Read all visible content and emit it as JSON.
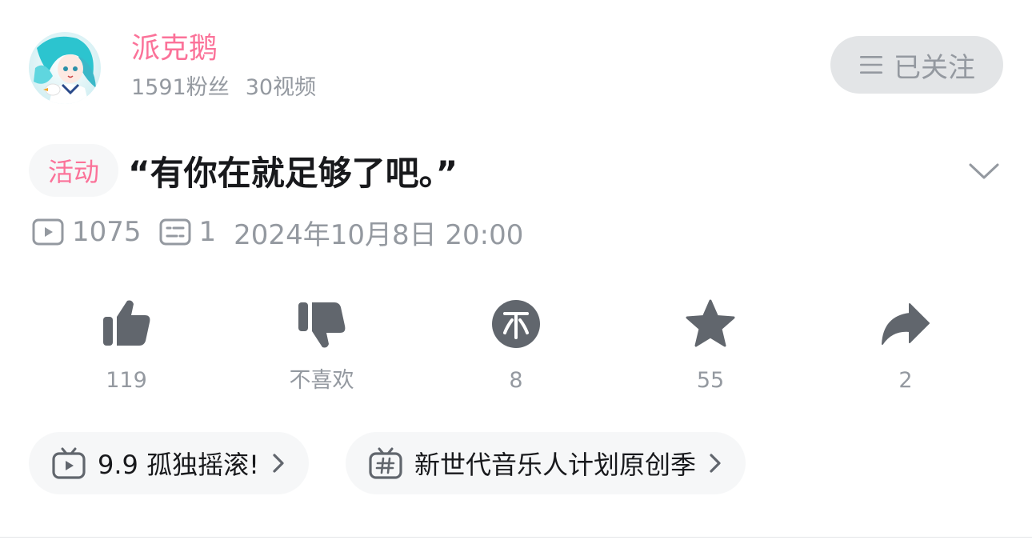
{
  "uploader": {
    "name": "派克鹅",
    "followers": "1591粉丝",
    "videos": "30视频",
    "follow_label": "已关注"
  },
  "video": {
    "tag": "活动",
    "title": "“有你在就足够了吧。”",
    "views": "1075",
    "danmaku": "1",
    "date": "2024年10月8日 20:00"
  },
  "actions": [
    {
      "name": "like",
      "icon": "thumb-up-icon",
      "label": "119"
    },
    {
      "name": "dislike",
      "icon": "thumb-down-icon",
      "label": "不喜欢"
    },
    {
      "name": "coin",
      "icon": "coin-icon",
      "label": "8"
    },
    {
      "name": "favorite",
      "icon": "star-icon",
      "label": "55"
    },
    {
      "name": "share",
      "icon": "share-icon",
      "label": "2"
    }
  ],
  "chips": [
    {
      "icon": "tv-icon",
      "label": "9.9 孤独摇滚!"
    },
    {
      "icon": "hashtag-icon",
      "label": "新世代音乐人计划原创季"
    }
  ],
  "colors": {
    "accent": "#fb7299",
    "icon_gray": "#61666d",
    "text_gray": "#9499a0"
  }
}
